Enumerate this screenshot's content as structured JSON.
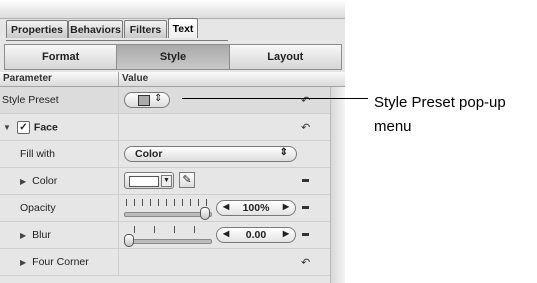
{
  "tabs": [
    "Properties",
    "Behaviors",
    "Filters",
    "Text"
  ],
  "active_tab": "Text",
  "segments": [
    "Format",
    "Style",
    "Layout"
  ],
  "active_segment": "Style",
  "header": {
    "parameter": "Parameter",
    "value": "Value"
  },
  "rows": {
    "style_preset": "Style Preset",
    "face": "Face",
    "fill_with": "Fill with",
    "fill_with_value": "Color",
    "color": "Color",
    "opacity": "Opacity",
    "opacity_value": "100%",
    "blur": "Blur",
    "blur_value": "0.00",
    "four_corner": "Four Corner"
  },
  "face_checked": true,
  "callout": {
    "label": "Style Preset pop-up menu"
  },
  "colors": {
    "panel": "#e6e6e6",
    "swatch": "#ffffff"
  },
  "icons": [
    "reset-arrow-icon",
    "disclosure-triangle-icon",
    "eyedropper-icon",
    "checkbox-icon",
    "popup-arrows-icon"
  ]
}
